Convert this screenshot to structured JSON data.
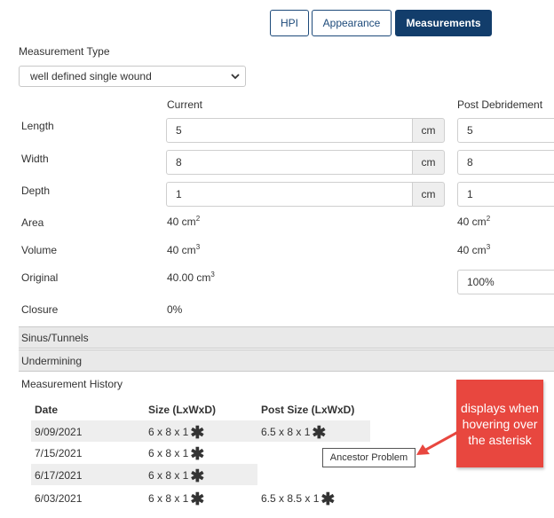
{
  "tabs": [
    {
      "label": "HPI",
      "active": false
    },
    {
      "label": "Appearance",
      "active": false
    },
    {
      "label": "Measurements",
      "active": true
    }
  ],
  "measurement_type": {
    "label": "Measurement Type",
    "selected": "well defined single wound"
  },
  "columns": {
    "current": "Current",
    "post": "Post Debridement"
  },
  "unit": "cm",
  "fields": {
    "length": {
      "label": "Length",
      "current": "5",
      "post": "5"
    },
    "width": {
      "label": "Width",
      "current": "8",
      "post": "8"
    },
    "depth": {
      "label": "Depth",
      "current": "1",
      "post": "1"
    }
  },
  "derived": {
    "area": {
      "label": "Area",
      "current": "40 cm",
      "current_exp": "2",
      "post": "40 cm",
      "post_exp": "2"
    },
    "volume": {
      "label": "Volume",
      "current": "40 cm",
      "current_exp": "3",
      "post": "40 cm",
      "post_exp": "3"
    },
    "original": {
      "label": "Original",
      "current": "40.00 cm",
      "current_exp": "3",
      "post": "100%"
    },
    "closure": {
      "label": "Closure",
      "current": "0%"
    }
  },
  "sections": {
    "sinus": "Sinus/Tunnels",
    "undermining": "Undermining"
  },
  "history": {
    "title": "Measurement History",
    "headers": {
      "date": "Date",
      "size": "Size (LxWxD)",
      "post_size": "Post Size (LxWxD)"
    },
    "rows": [
      {
        "date": "9/09/2021",
        "size": "6 x 8 x 1",
        "post_size": "6.5 x 8 x 1"
      },
      {
        "date": "7/15/2021",
        "size": "6 x 8 x 1",
        "post_size": ""
      },
      {
        "date": "6/17/2021",
        "size": "6 x 8 x 1",
        "post_size": ""
      },
      {
        "date": "6/03/2021",
        "size": "6 x 8 x 1",
        "post_size": "6.5 x 8.5 x 1"
      }
    ],
    "asterisk": "✱"
  },
  "tooltip": "Ancestor Problem",
  "callout": "displays when hovering over the asterisk",
  "colors": {
    "primary": "#123d6b",
    "callout": "#e8473f",
    "row_stripe": "#eeeeee"
  }
}
